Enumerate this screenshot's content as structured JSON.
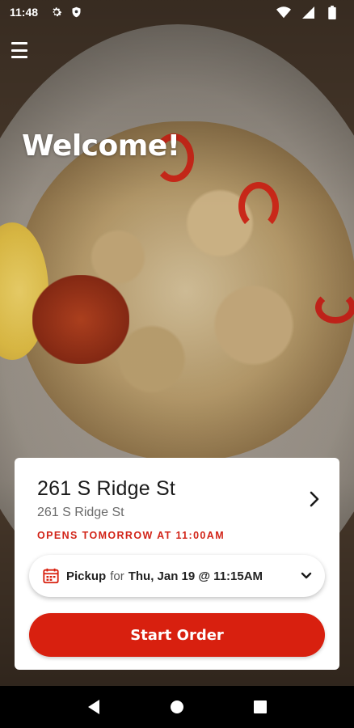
{
  "status_bar": {
    "time": "11:48",
    "icons_left": [
      "settings-icon",
      "shield-icon"
    ],
    "icons_right": [
      "wifi-icon",
      "cellular-icon",
      "battery-icon"
    ]
  },
  "header": {
    "menu_icon": "hamburger-menu-icon",
    "welcome": "Welcome!"
  },
  "location_card": {
    "name": "261 S Ridge St",
    "address": "261 S Ridge St",
    "hours_status": "OPENS TOMORROW AT 11:00AM",
    "chevron_icon": "chevron-right-icon"
  },
  "pickup": {
    "icon": "calendar-icon",
    "mode": "Pickup",
    "connector": "for",
    "when": "Thu, Jan 19 @ 11:15AM",
    "dropdown_icon": "chevron-down-icon"
  },
  "actions": {
    "start_order": "Start Order"
  },
  "colors": {
    "accent": "#d8200f",
    "hours_status": "#d22418",
    "card_bg": "#ffffff"
  },
  "nav_bar": {
    "icons": [
      "back-icon",
      "home-icon",
      "recents-icon"
    ]
  }
}
